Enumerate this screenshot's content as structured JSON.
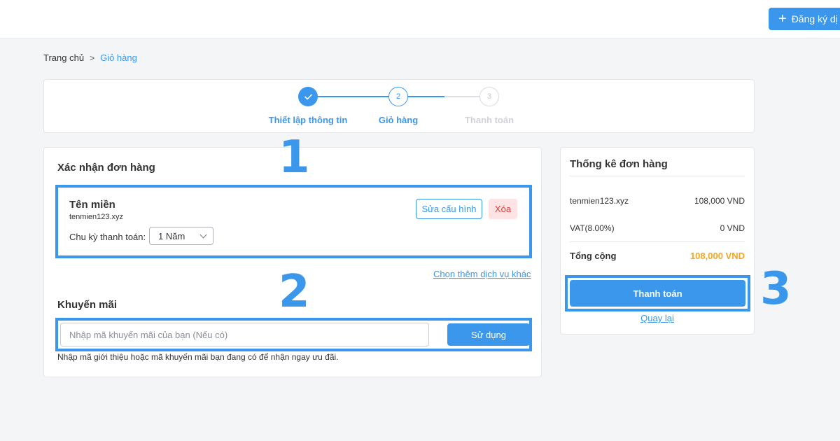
{
  "header": {
    "register_label": "Đăng ký dị"
  },
  "breadcrumb": {
    "home": "Trang chủ",
    "current": "Giỏ hàng"
  },
  "steps": [
    {
      "label": "Thiết lập thông tin",
      "state": "done"
    },
    {
      "label": "Giỏ hàng",
      "number": "2",
      "state": "active"
    },
    {
      "label": "Thanh toán",
      "number": "3",
      "state": "pending"
    }
  ],
  "order": {
    "title": "Xác nhận đơn hàng",
    "item_name": "Tên miền",
    "item_domain": "tenmien123.xyz",
    "cycle_label": "Chu kỳ thanh toán:",
    "cycle_value": "1 Năm",
    "edit_label": "Sửa cấu hình",
    "delete_label": "Xóa",
    "more_services": "Chọn thêm dịch vụ khác"
  },
  "promo": {
    "title": "Khuyến mãi",
    "placeholder": "Nhập mã khuyến mãi của bạn (Nếu có)",
    "apply_label": "Sử dụng",
    "hint": "Nhập mã giới thiệu hoặc mã khuyến mãi bạn đang có để nhận ngay ưu đãi."
  },
  "summary": {
    "title": "Thống kê đơn hàng",
    "rows": [
      {
        "label": "tenmien123.xyz",
        "value": "108,000 VND"
      },
      {
        "label": "VAT(8.00%)",
        "value": "0 VND"
      }
    ],
    "total_label": "Tổng cộng",
    "total_value": "108,000 VND",
    "pay_label": "Thanh toán",
    "back_label": "Quay lại"
  },
  "annotations": [
    "1",
    "2",
    "3"
  ],
  "colors": {
    "primary": "#3a97ec",
    "total": "#f5a623",
    "danger": "#e23b3b"
  }
}
